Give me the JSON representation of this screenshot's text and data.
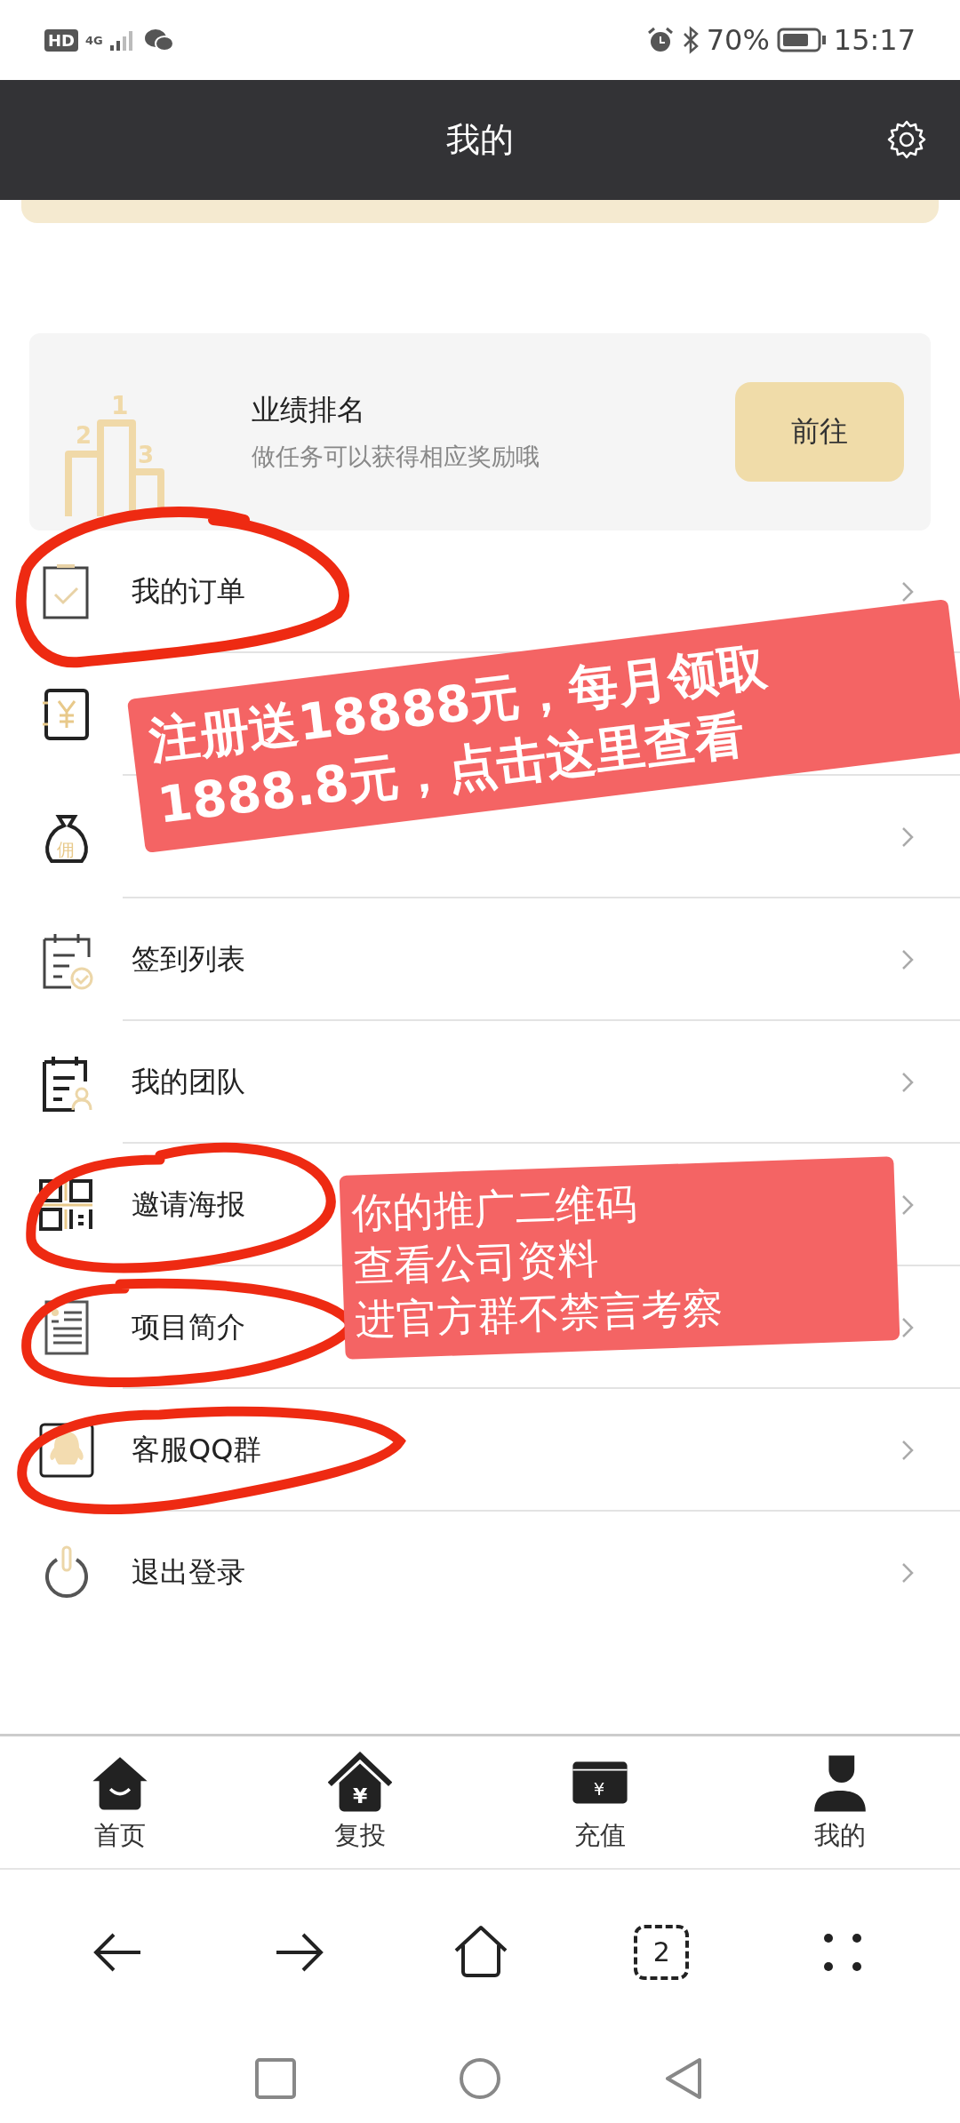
{
  "status_bar": {
    "hd": "HD",
    "network": "4G",
    "battery": "70%",
    "time": "15:17"
  },
  "header": {
    "title": "我的"
  },
  "ranking_card": {
    "title": "业绩排名",
    "subtitle": "做任务可以获得相应奖励哦",
    "button": "前往",
    "podium": [
      "1",
      "2",
      "3"
    ]
  },
  "menu": [
    {
      "kind": "order",
      "label": "我的订单"
    },
    {
      "kind": "income",
      "chevron": false
    },
    {
      "kind": "commission",
      "icon_text": "佣"
    },
    {
      "kind": "checkin",
      "label": "签到列表"
    },
    {
      "kind": "team",
      "label": "我的团队"
    },
    {
      "kind": "poster",
      "label": "邀请海报"
    },
    {
      "kind": "intro",
      "label": "项目简介"
    },
    {
      "kind": "qq",
      "label": "客服QQ群"
    },
    {
      "kind": "logout",
      "label": "退出登录"
    }
  ],
  "tab_bar": [
    {
      "kind": "home",
      "label": "首页"
    },
    {
      "kind": "reinvest",
      "label": "复投",
      "icon_text": "¥"
    },
    {
      "kind": "recharge",
      "label": "充值",
      "icon_text": "¥"
    },
    {
      "kind": "me",
      "label": "我的"
    }
  ],
  "browser_bar": {
    "tabs_count": "2"
  },
  "annotations": [
    {
      "kind": "bold",
      "lines": [
        "注册送18888元，每月领取",
        "1888.8元，点击这里查看"
      ]
    },
    {
      "kind": "plain",
      "lines": [
        "你的推广二维码",
        "查看公司资料",
        "进官方群不禁言考察"
      ]
    }
  ]
}
